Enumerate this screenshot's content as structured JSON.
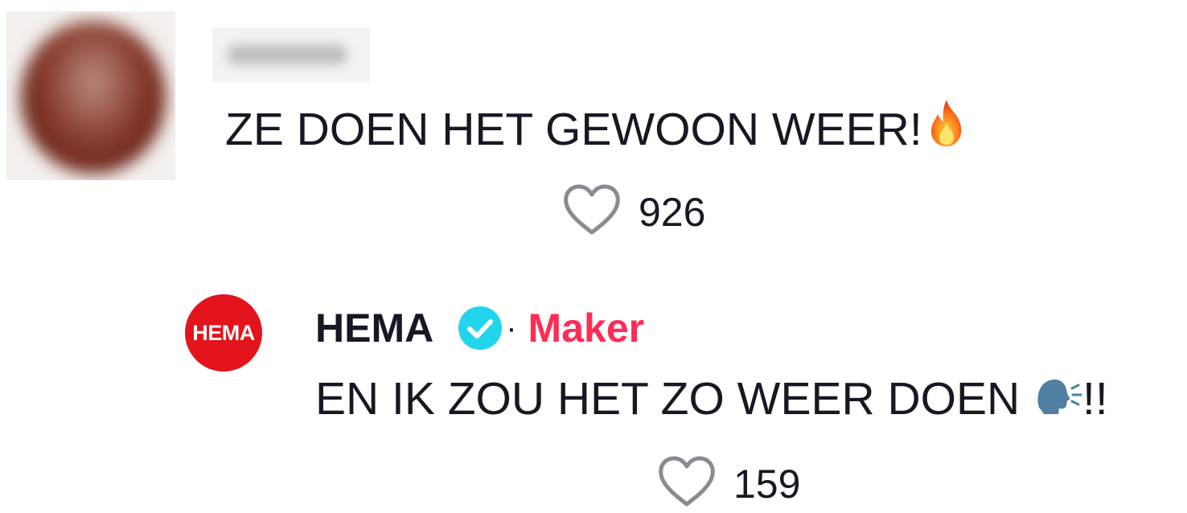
{
  "comment": {
    "text": "ZE DOEN HET GEWOON WEER!",
    "emoji": "fire-emoji",
    "likes": "926"
  },
  "reply": {
    "author": "HEMA",
    "avatar_text": "HEMA",
    "separator": "·",
    "role": "Maker",
    "text": "EN IK ZOU HET ZO WEER DOEN ",
    "suffix": "!!",
    "emoji": "speaking-head-emoji",
    "likes": "159"
  },
  "colors": {
    "text": "#161823",
    "maker": "#fe2c55",
    "verified": "#20d5ec",
    "hema_red": "#e3141b",
    "heart_outline": "#8a8b91"
  }
}
